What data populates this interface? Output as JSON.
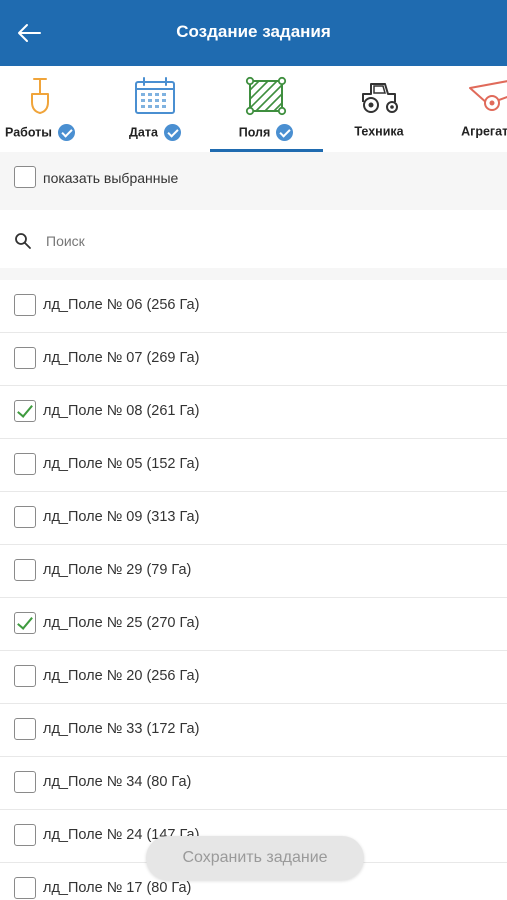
{
  "header": {
    "title": "Создание задания",
    "back_icon": "arrow-left-icon"
  },
  "tabs": [
    {
      "label": "Работы",
      "icon": "shovel-icon",
      "done": true
    },
    {
      "label": "Дата",
      "icon": "calendar-icon",
      "done": true
    },
    {
      "label": "Поля",
      "icon": "field-polygon-icon",
      "done": true,
      "active": true
    },
    {
      "label": "Техника",
      "icon": "tractor-icon",
      "done": false
    },
    {
      "label": "Агрегаты",
      "icon": "implement-icon",
      "done": false
    }
  ],
  "filter": {
    "show_selected_label": "показать выбранные"
  },
  "search": {
    "placeholder": "Поиск",
    "value": ""
  },
  "fields": [
    {
      "name": "лд_Поле № 06 (256 Га)",
      "checked": false
    },
    {
      "name": "лд_Поле № 07 (269 Га)",
      "checked": false
    },
    {
      "name": "лд_Поле № 08 (261 Га)",
      "checked": true
    },
    {
      "name": "лд_Поле № 05 (152 Га)",
      "checked": false
    },
    {
      "name": "лд_Поле № 09 (313 Га)",
      "checked": false
    },
    {
      "name": "лд_Поле № 29 (79 Га)",
      "checked": false
    },
    {
      "name": "лд_Поле № 25 (270 Га)",
      "checked": true
    },
    {
      "name": "лд_Поле № 20 (256 Га)",
      "checked": false
    },
    {
      "name": "лд_Поле № 33 (172 Га)",
      "checked": false
    },
    {
      "name": "лд_Поле № 34 (80 Га)",
      "checked": false
    },
    {
      "name": "лд_Поле № 24 (147 Га)",
      "checked": false
    },
    {
      "name": "лд_Поле № 17 (80 Га)",
      "checked": false
    }
  ],
  "save_button": {
    "label": "Сохранить задание"
  },
  "colors": {
    "header": "#1f6bb0",
    "check_badge": "#4a8fd1",
    "checkmark": "#3f9b3f"
  }
}
